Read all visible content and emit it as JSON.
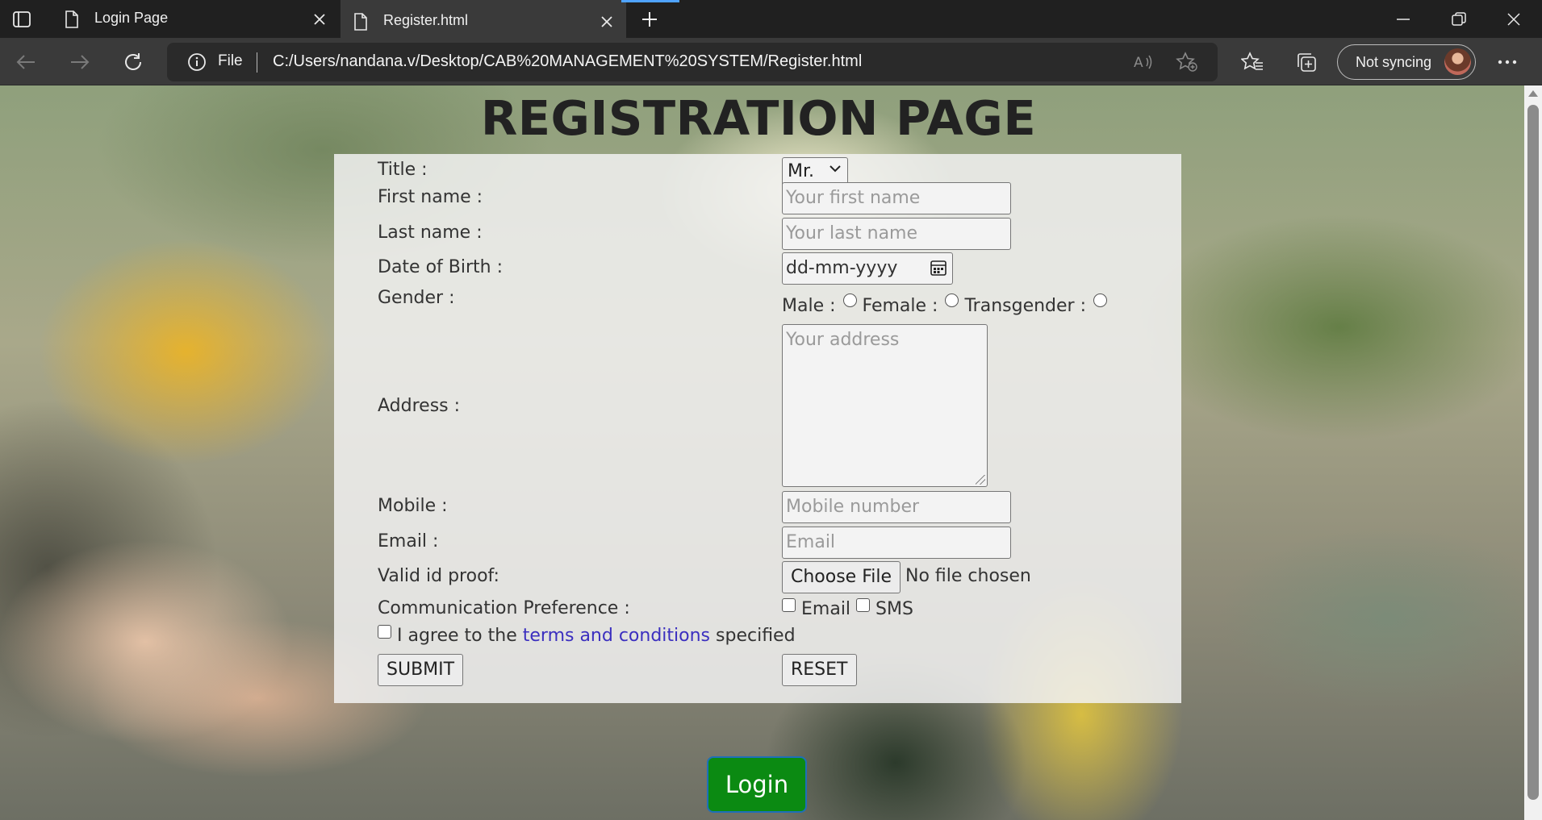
{
  "browser": {
    "tabs": [
      {
        "title": "Login Page",
        "icon": "page-icon"
      },
      {
        "title": "Register.html",
        "icon": "page-icon"
      }
    ],
    "address": {
      "scheme_label": "File",
      "url": "C:/Users/nandana.v/Desktop/CAB%20MANAGEMENT%20SYSTEM/Register.html"
    },
    "profile_label": "Not syncing",
    "accent": "#4fa3ff"
  },
  "page": {
    "heading": "REGISTRATION PAGE",
    "form": {
      "title_label": "Title :",
      "title_value": "Mr.",
      "first_name_label": "First name :",
      "first_name_placeholder": "Your first name",
      "last_name_label": "Last name :",
      "last_name_placeholder": "Your last name",
      "dob_label": "Date of Birth :",
      "dob_placeholder": "dd-mm-yyyy",
      "gender_label": "Gender :",
      "gender_options": [
        "Male :",
        "Female :",
        "Transgender :"
      ],
      "address_label": "Address :",
      "address_placeholder": "Your address",
      "mobile_label": "Mobile :",
      "mobile_placeholder": "Mobile number",
      "email_label": "Email :",
      "email_placeholder": "Email",
      "id_proof_label": "Valid id proof:",
      "choose_file_label": "Choose File",
      "no_file_text": "No file chosen",
      "comm_pref_label": "Communication Preference :",
      "comm_options": [
        "Email",
        "SMS"
      ],
      "agree_prefix": "I agree to the",
      "agree_link": "terms and conditions",
      "agree_suffix": "specified",
      "submit_label": "SUBMIT",
      "reset_label": "RESET"
    },
    "login_label": "Login",
    "login_color": "#0b8a12"
  }
}
